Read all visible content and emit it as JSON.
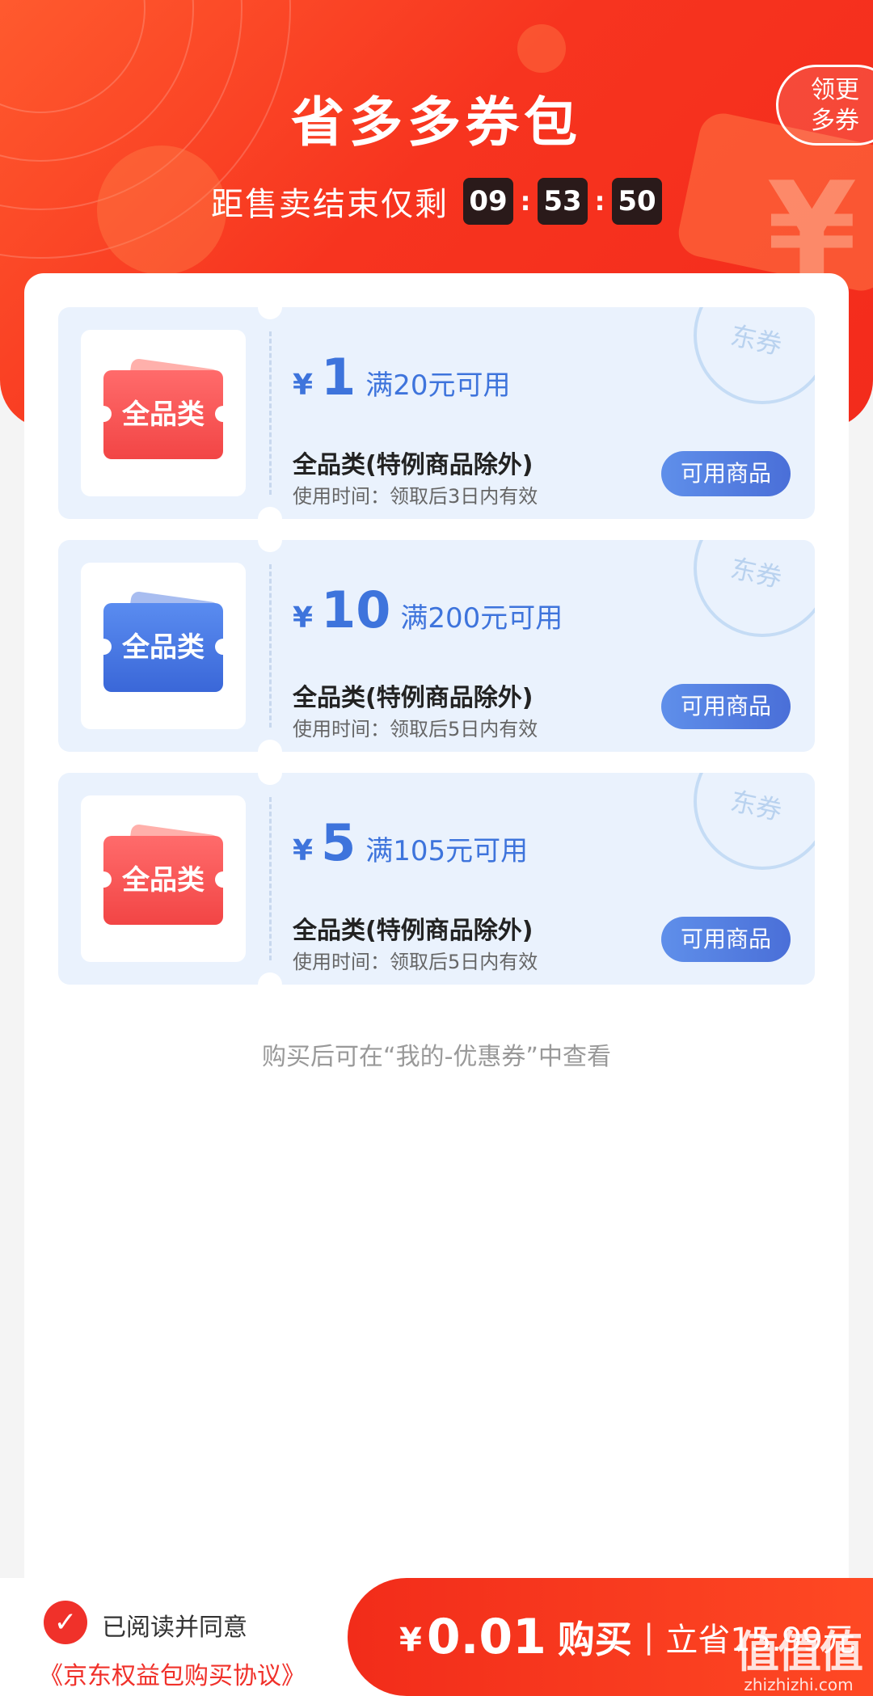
{
  "header": {
    "title": "省多多券包",
    "more_button": "领更\n多券",
    "countdown_label": "距售卖结束仅剩",
    "countdown": {
      "hours": "09",
      "minutes": "53",
      "seconds": "50"
    },
    "bg_icon": "yen-icon"
  },
  "coupons": [
    {
      "theme": "red",
      "tag": "全品类",
      "yen": "¥",
      "amount": "1",
      "condition": "满20元可用",
      "title": "全品类(特例商品除外)",
      "time": "使用时间：领取后3日内有效",
      "button": "可用商品",
      "stamp": "东券"
    },
    {
      "theme": "blue",
      "tag": "全品类",
      "yen": "¥",
      "amount": "10",
      "condition": "满200元可用",
      "title": "全品类(特例商品除外)",
      "time": "使用时间：领取后5日内有效",
      "button": "可用商品",
      "stamp": "东券"
    },
    {
      "theme": "red",
      "tag": "全品类",
      "yen": "¥",
      "amount": "5",
      "condition": "满105元可用",
      "title": "全品类(特例商品除外)",
      "time": "使用时间：领取后5日内有效",
      "button": "可用商品",
      "stamp": "东券"
    }
  ],
  "hint": "购买后可在“我的-优惠券”中查看",
  "bottom": {
    "check_icon": "check-icon",
    "agree_text": "已阅读并同意",
    "agreement_link": "《京东权益包购买协议》",
    "yen": "¥",
    "price": "0.01",
    "buy_label": "购买",
    "separator": "|",
    "save_text": "立省15.99元",
    "watermark_main": "值值值",
    "watermark_sub": "zhizhizhi.com"
  },
  "colors": {
    "accent": "#f0312a",
    "coupon_blue": "#3e74dc"
  }
}
